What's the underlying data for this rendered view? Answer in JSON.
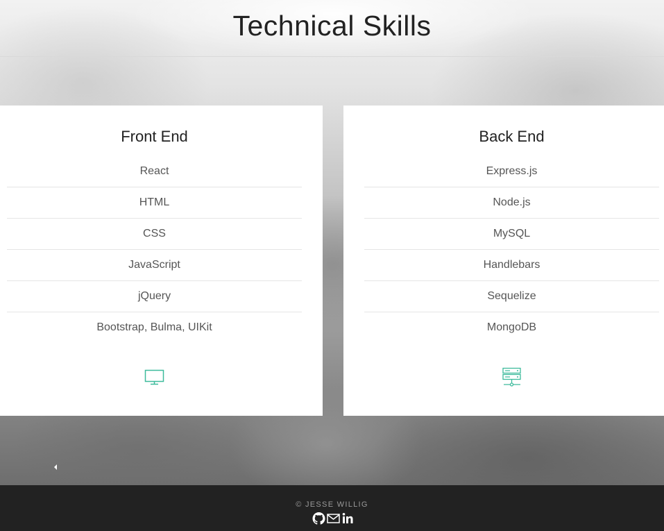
{
  "header": {
    "title": "Technical Skills"
  },
  "front_end": {
    "title": "Front End",
    "skills": [
      "React",
      "HTML",
      "CSS",
      "JavaScript",
      "jQuery",
      "Bootstrap, Bulma, UIKit"
    ],
    "icon": "monitor-icon"
  },
  "back_end": {
    "title": "Back End",
    "skills": [
      "Express.js",
      "Node.js",
      "MySQL",
      "Handlebars",
      "Sequelize",
      "MongoDB"
    ],
    "icon": "server-icon"
  },
  "footer": {
    "copyright": "© JESSE WILLIG",
    "social_icons": [
      "github-icon",
      "email-icon",
      "linkedin-icon"
    ]
  },
  "colors": {
    "accent": "#3dbb9c",
    "footer_bg": "#222222"
  }
}
